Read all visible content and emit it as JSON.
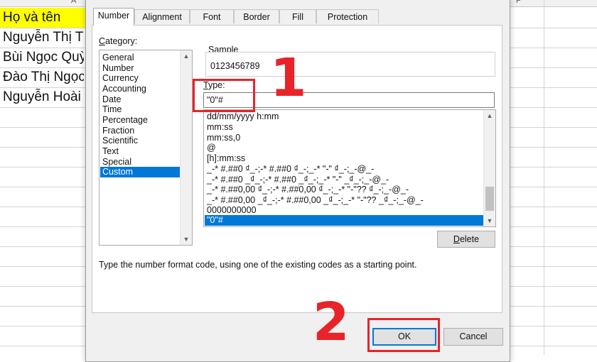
{
  "spreadsheet": {
    "header_cells": [
      "A",
      "P"
    ],
    "rows": [
      {
        "text": "Họ và tên",
        "highlight": "#ffff00"
      },
      {
        "text": "Nguyễn Thị Th"
      },
      {
        "text": "Bùi Ngọc Quỳ"
      },
      {
        "text": "Đào Thị Ngọc"
      },
      {
        "text": "Nguyễn Hoài"
      }
    ]
  },
  "dialog": {
    "tabs": [
      {
        "label": "Number",
        "active": true
      },
      {
        "label": "Alignment",
        "active": false
      },
      {
        "label": "Font",
        "active": false
      },
      {
        "label": "Border",
        "active": false
      },
      {
        "label": "Fill",
        "active": false
      },
      {
        "label": "Protection",
        "active": false
      }
    ],
    "category_label": "Category:",
    "categories": [
      "General",
      "Number",
      "Currency",
      "Accounting",
      "Date",
      "Time",
      "Percentage",
      "Fraction",
      "Scientific",
      "Text",
      "Special",
      "Custom"
    ],
    "selected_category": "Custom",
    "sample_label": "Sample",
    "sample_value": "0123456789",
    "type_label": "Type:",
    "type_value": "\"0\"#",
    "format_codes": [
      "dd/mm/yyyy h:mm",
      "mm:ss",
      "mm:ss,0",
      "@",
      "[h]:mm:ss",
      "_-* #.##0 ₫_-;-* #.##0 ₫_-;_-* \"-\" ₫_-;_-@_-",
      "_-* #.##0 _₫_-;-* #.##0 _₫_-;_-* \"-\" _₫_-;_-@_-",
      "_-* #.##0,00 ₫_-;-* #.##0,00 ₫_-;_-* \"-\"?? ₫_-;_-@_-",
      "_-* #.##0,00 _₫_-;-* #.##0,00 _₫_-;_-* \"-\"?? _₫_-;_-@_-",
      "0000000000",
      "\"0\"#"
    ],
    "selected_format": "\"0\"#",
    "delete_button": "Delete",
    "hint": "Type the number format code, using one of the existing codes as a starting point.",
    "ok_button": "OK",
    "cancel_button": "Cancel"
  },
  "annotations": {
    "step1": "1",
    "step2": "2",
    "color": "#e8232a"
  },
  "colors": {
    "selection": "#0078d7",
    "dialog_bg": "#f0f0f0"
  }
}
